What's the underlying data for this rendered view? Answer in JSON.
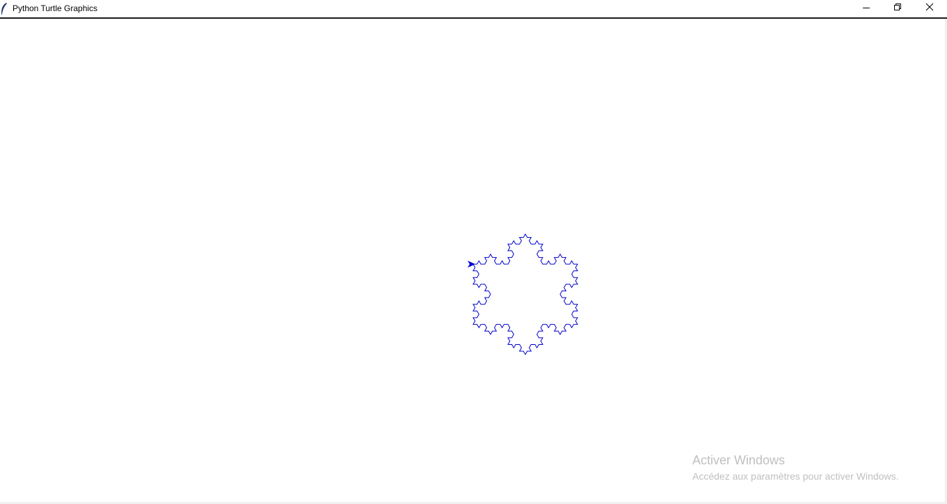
{
  "window": {
    "title": "Python Turtle Graphics",
    "icon": "feather-icon"
  },
  "controls": {
    "minimize_icon": "minimize-icon",
    "restore_icon": "restore-icon",
    "close_icon": "close-icon"
  },
  "drawing": {
    "shape": "koch-snowflake",
    "pen_color": "#0000cc",
    "turtle_icon": "turtle-arrow-icon",
    "recursion_depth": 3
  },
  "activation_watermark": {
    "title": "Activer Windows",
    "subtitle": "Accédez aux paramètres pour activer Windows."
  }
}
